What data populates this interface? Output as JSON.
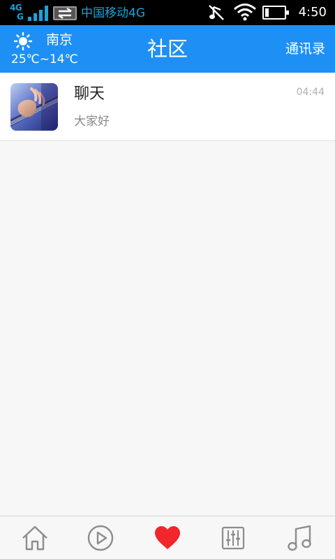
{
  "status_bar": {
    "network_type_top": "4G",
    "network_type_bottom": "G",
    "carrier": "中国移动4G",
    "time": "4:50",
    "battery_level": 0.2,
    "icons": [
      "signal-icon",
      "data-transfer-icon",
      "mute-icon",
      "wifi-icon",
      "battery-icon"
    ]
  },
  "header": {
    "weather_icon": "sun-icon",
    "city": "南京",
    "temperature": "25℃~14℃",
    "title": "社区",
    "contacts_label": "通讯录",
    "background_color": "#1e90f5"
  },
  "chats": [
    {
      "name": "聊天",
      "last_message": "大家好",
      "time": "04:44",
      "avatar_icon": "guitar-avatar"
    }
  ],
  "tab_bar": {
    "tabs": [
      {
        "icon": "home-icon",
        "active": false
      },
      {
        "icon": "play-icon",
        "active": false
      },
      {
        "icon": "heart-icon",
        "active": true
      },
      {
        "icon": "equalizer-icon",
        "active": false
      },
      {
        "icon": "music-note-icon",
        "active": false
      }
    ],
    "active_color": "#f2262d",
    "inactive_color": "#8c8c8c"
  }
}
